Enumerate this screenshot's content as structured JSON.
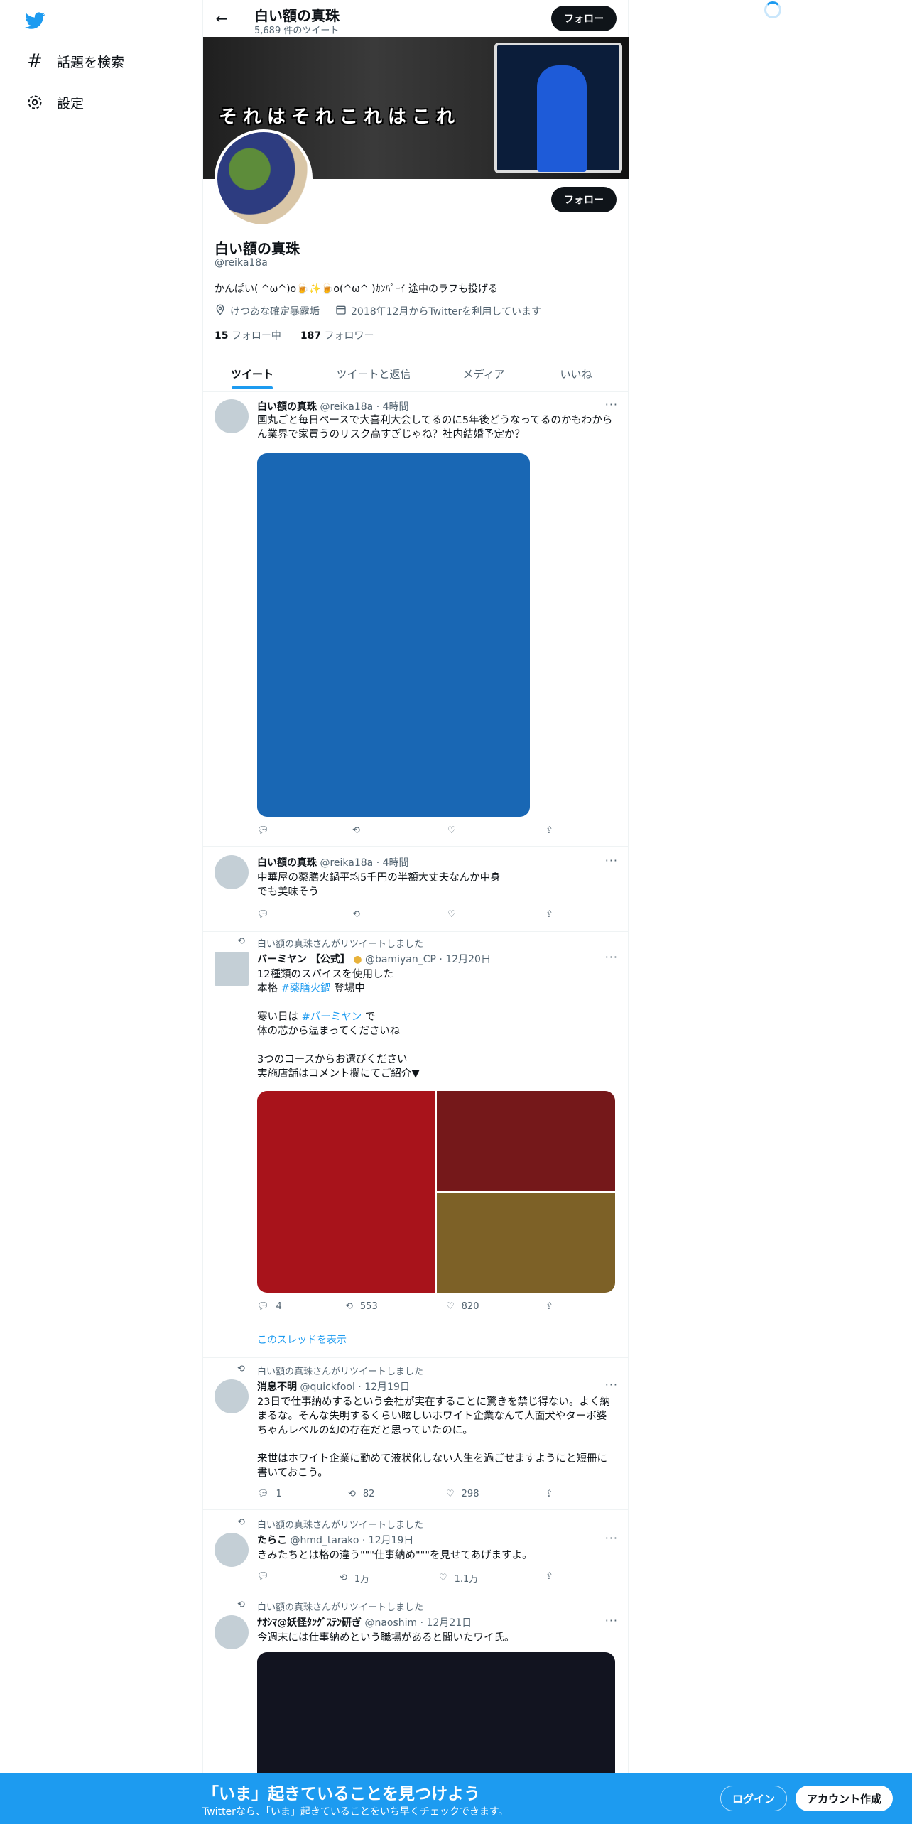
{
  "nav": {
    "explore_label": "話題を検索",
    "settings_label": "設定"
  },
  "header": {
    "title": "白い額の真珠",
    "tweet_count": "5,689 件のツイート",
    "follow_label": "フォロー"
  },
  "banner": {
    "text": "それはそれこれはこれ"
  },
  "profile": {
    "name": "白い額の真珠",
    "handle": "@reika18a",
    "bio": "かんぱい( ^ω^)o🍺✨🍺o(^ω^ )ｶﾝﾊﾟｰｲ 途中のラフも投げる",
    "location": "けつあな確定暴露垢",
    "joined": "2018年12月からTwitterを利用しています",
    "following_count": "15",
    "following_label": "フォロー中",
    "followers_count": "187",
    "followers_label": "フォロワー",
    "follow_label": "フォロー"
  },
  "tabs": [
    "ツイート",
    "ツイートと返信",
    "メディア",
    "いいね"
  ],
  "tweets": [
    {
      "name": "白い額の真珠",
      "handle": "@reika18a",
      "time": "4時間",
      "text": "国丸ごと毎日ペースで大喜利大会してるのに5年後どうなってるのかもわからん業界で家買うのリスク高すぎじゃね？社内結婚予定か？",
      "media_color": "#1967b4"
    },
    {
      "name": "白い額の真珠",
      "handle": "@reika18a",
      "time": "4時間",
      "text": "中華屋の薬膳火鍋平均5千円の半額大丈夫なんか中身\nでも美味そう"
    },
    {
      "retweet_label": "白い額の真珠さんがリツイートしました",
      "name": "バーミヤン 【公式】",
      "handle": "@bamiyan_CP",
      "time": "12月20日",
      "text_line1": "12種類のスパイスを使用した",
      "text_line2_pre": "本格 ",
      "hashtag1": "#薬膳火鍋",
      "text_line2_post": " 登場中",
      "text_line4_pre": "寒い日は ",
      "hashtag2": "#バーミヤン",
      "text_line4_post": " で",
      "text_line5": "体の芯から温まってくださいね",
      "text_line7": "3つのコースからお選びください",
      "text_line8": "実施店舗はコメント欄にてご紹介▼",
      "replies": "4",
      "retweets": "553",
      "likes": "820",
      "show_thread": "このスレッドを表示",
      "media_colors": [
        "#a8131b",
        "#75181a",
        "#7d6127"
      ]
    },
    {
      "retweet_label": "白い額の真珠さんがリツイートしました",
      "name": "消息不明",
      "handle": "@quickfool",
      "time": "12月19日",
      "text": "23日で仕事納めするという会社が実在することに驚きを禁じ得ない。よく納まるな。そんな失明するくらい眩しいホワイト企業なんて人面犬やターボ婆ちゃんレベルの幻の存在だと思っていたのに。\n\n来世はホワイト企業に勤めて液状化しない人生を過ごせますようにと短冊に書いておこう。",
      "replies": "1",
      "retweets": "82",
      "likes": "298"
    },
    {
      "retweet_label": "白い額の真珠さんがリツイートしました",
      "name": "たらこ",
      "handle": "@hmd_tarako",
      "time": "12月19日",
      "text": "きみたちとは格の違う\"\"\"仕事納め\"\"\"を見せてあげますよ。",
      "retweets": "1万",
      "likes": "1.1万"
    },
    {
      "retweet_label": "白い額の真珠さんがリツイートしました",
      "name": "ﾅｵｼﾏ@妖怪ﾀﾝｸﾞｽﾃﾝ研ぎ",
      "handle": "@naoshim",
      "time": "12月21日",
      "text": "今週末には仕事納めという職場があると聞いたワイ氏。",
      "media_color": "#121420"
    }
  ],
  "bottom_bar": {
    "title": "「いま」起きていることを見つけよう",
    "subtitle": "Twitterなら、「いま」起きていることをいち早くチェックできます。",
    "login_label": "ログイン",
    "signup_label": "アカウント作成"
  }
}
